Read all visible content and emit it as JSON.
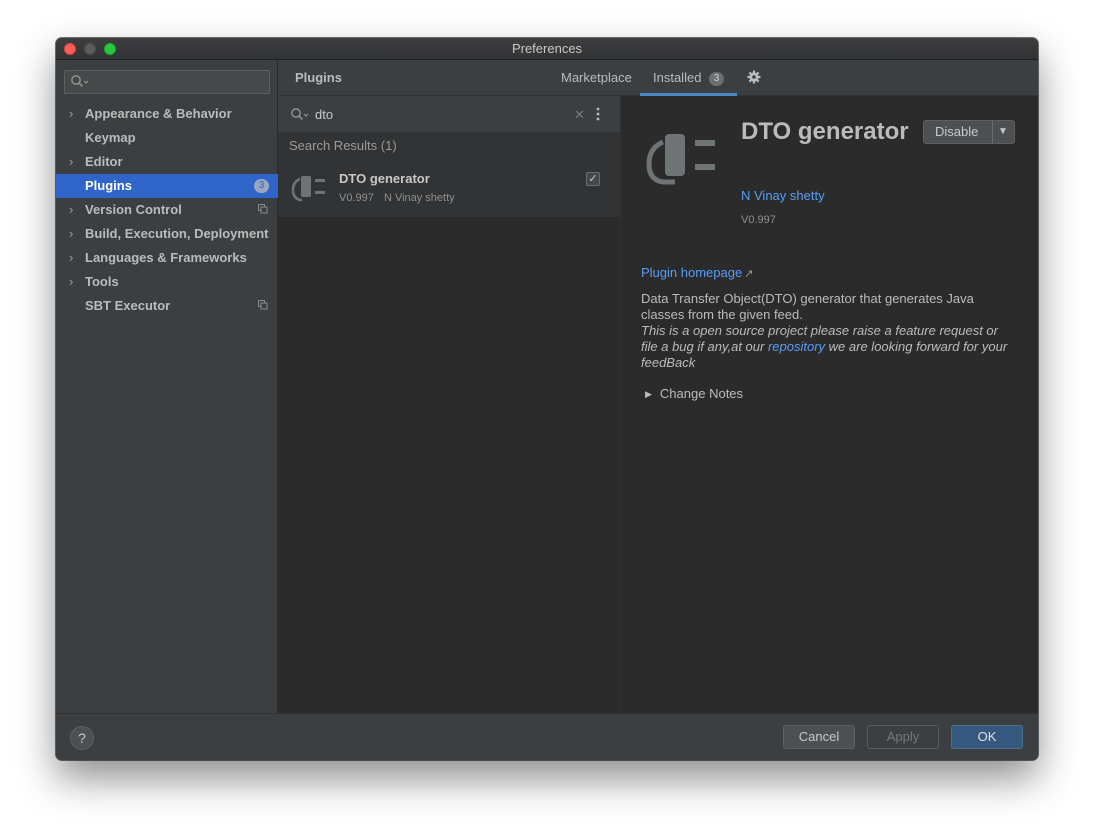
{
  "window": {
    "title": "Preferences"
  },
  "sidebar": {
    "search_placeholder": "",
    "items": [
      {
        "label": "Appearance & Behavior",
        "expandable": true
      },
      {
        "label": "Keymap",
        "expandable": false
      },
      {
        "label": "Editor",
        "expandable": true
      },
      {
        "label": "Plugins",
        "expandable": false,
        "selected": true,
        "badge": "3"
      },
      {
        "label": "Version Control",
        "expandable": true,
        "project_icon": true
      },
      {
        "label": "Build, Execution, Deployment",
        "expandable": true
      },
      {
        "label": "Languages & Frameworks",
        "expandable": true
      },
      {
        "label": "Tools",
        "expandable": true
      },
      {
        "label": "SBT Executor",
        "expandable": false,
        "project_icon": true
      }
    ]
  },
  "header": {
    "title": "Plugins",
    "tabs": [
      {
        "label": "Marketplace"
      },
      {
        "label": "Installed",
        "count": "3",
        "active": true
      }
    ]
  },
  "list": {
    "search_value": "dto",
    "results_label": "Search Results (1)",
    "plugins": [
      {
        "name": "DTO generator",
        "version": "V0.997",
        "vendor": "N Vinay shetty",
        "enabled": true
      }
    ]
  },
  "detail": {
    "name": "DTO generator",
    "vendor": "N Vinay shetty",
    "version": "V0.997",
    "disable_label": "Disable",
    "homepage_label": "Plugin homepage",
    "homepage_arrow": "↗",
    "description_line1": "Data Transfer Object(DTO) generator that generates Java classes from the given feed.",
    "description_italic_before": "This is a open source project please raise a feature request or file a bug if any,at our",
    "description_link": "repository",
    "description_italic_after": "we are looking forward for your feedBack",
    "change_notes_label": "Change Notes"
  },
  "footer": {
    "help_label": "?",
    "cancel_label": "Cancel",
    "apply_label": "Apply",
    "ok_label": "OK"
  },
  "colors": {
    "selection": "#2f65ca",
    "link": "#589df6",
    "tab_underline": "#4a88c7",
    "ok_button": "#365880"
  }
}
